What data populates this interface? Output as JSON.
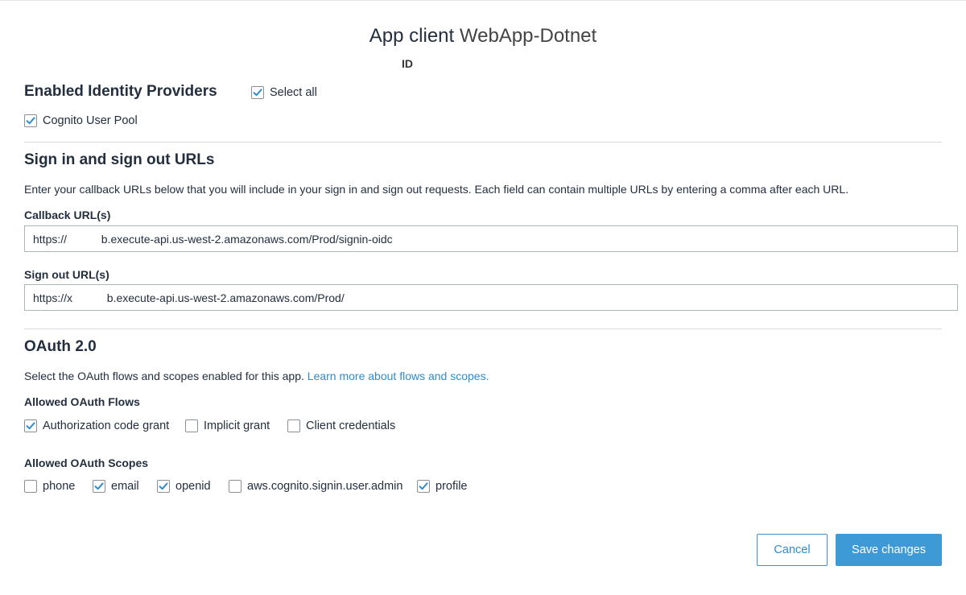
{
  "header": {
    "title_prefix": "App client ",
    "title_name": "WebApp-Dotnet",
    "id_label": "ID"
  },
  "identity_providers": {
    "heading": "Enabled Identity Providers",
    "select_all": {
      "label": "Select all",
      "checked": true
    },
    "providers": [
      {
        "label": "Cognito User Pool",
        "checked": true
      }
    ]
  },
  "urls": {
    "heading": "Sign in and sign out URLs",
    "description": "Enter your callback URLs below that you will include in your sign in and sign out requests. Each field can contain multiple URLs by entering a comma after each URL.",
    "callback_label": "Callback URL(s)",
    "callback_value": "https://           b.execute-api.us-west-2.amazonaws.com/Prod/signin-oidc",
    "signout_label": "Sign out URL(s)",
    "signout_value": "https://x           b.execute-api.us-west-2.amazonaws.com/Prod/"
  },
  "oauth": {
    "heading": "OAuth 2.0",
    "description": "Select the OAuth flows and scopes enabled for this app.",
    "learn_more": "Learn more about flows and scopes.",
    "flows_label": "Allowed OAuth Flows",
    "flows": [
      {
        "label": "Authorization code grant",
        "checked": true
      },
      {
        "label": "Implicit grant",
        "checked": false
      },
      {
        "label": "Client credentials",
        "checked": false
      }
    ],
    "scopes_label": "Allowed OAuth Scopes",
    "scopes": [
      {
        "label": "phone",
        "checked": false
      },
      {
        "label": "email",
        "checked": true
      },
      {
        "label": "openid",
        "checked": true
      },
      {
        "label": "aws.cognito.signin.user.admin",
        "checked": false
      },
      {
        "label": "profile",
        "checked": true
      }
    ]
  },
  "actions": {
    "cancel": "Cancel",
    "save": "Save changes"
  },
  "colors": {
    "accent": "#3e9ad6",
    "link": "#2f8bd0",
    "check": "#2f8bd0"
  }
}
